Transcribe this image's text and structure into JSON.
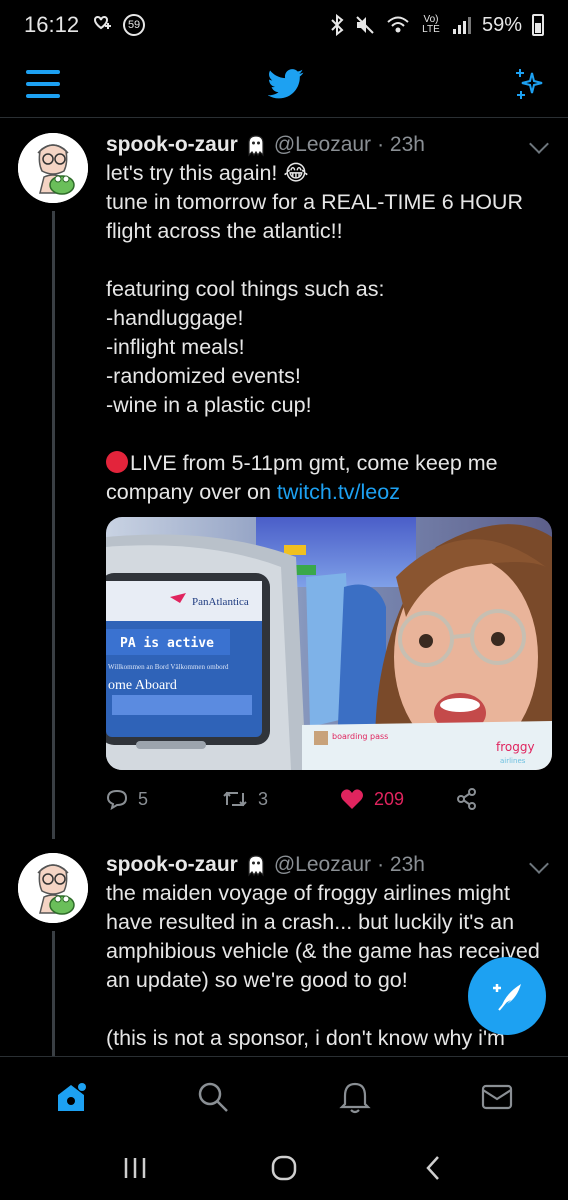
{
  "status_bar": {
    "time": "16:12",
    "notification_count": "59",
    "network_label": "Vo) LTE",
    "battery": "59%"
  },
  "app": {
    "brand_color": "#1da1f2",
    "icons": [
      "menu-icon",
      "twitter-bird-icon",
      "sparkle-icon"
    ]
  },
  "tweets": [
    {
      "name": "spook-o-zaur",
      "handle": "@Leozaur",
      "time": "· 23h",
      "text_main": "let's try this again! 😂\ntune in tomorrow for a REAL-TIME 6 HOUR flight across the atlantic!!\n\nfeaturing cool things such as:\n-handluggage!\n-inflight meals!\n-randomized events!\n-wine in a plastic cup!\n\n",
      "live_text": "LIVE from 5-11pm gmt, come keep me company over on ",
      "link": "twitch.tv/leoz",
      "media": {
        "screen_brand": "PanAtlantica",
        "screen_status": "PA is active",
        "screen_welcome_langs": "Willkommen an Bord   Välkommen ombord",
        "screen_welcome": "ome Aboard",
        "card_title": "boarding pass",
        "card_brand": "froggy",
        "card_sub": "airlines"
      },
      "replies": "5",
      "retweets": "3",
      "likes": "209"
    },
    {
      "name": "spook-o-zaur",
      "handle": "@Leozaur",
      "time": "· 23h",
      "text_main": "the maiden voyage of froggy airlines might have resulted in a crash... but luckily it's an amphibious vehicle (& the game has received an update) so we're good to go!\n\n(this is not a sponsor, i don't know why i'm putting myself through this again, please"
    }
  ],
  "bottom_nav": [
    "home-icon",
    "search-icon",
    "notifications-icon",
    "messages-icon"
  ],
  "system_nav": [
    "recents-icon",
    "home-button-icon",
    "back-icon"
  ]
}
